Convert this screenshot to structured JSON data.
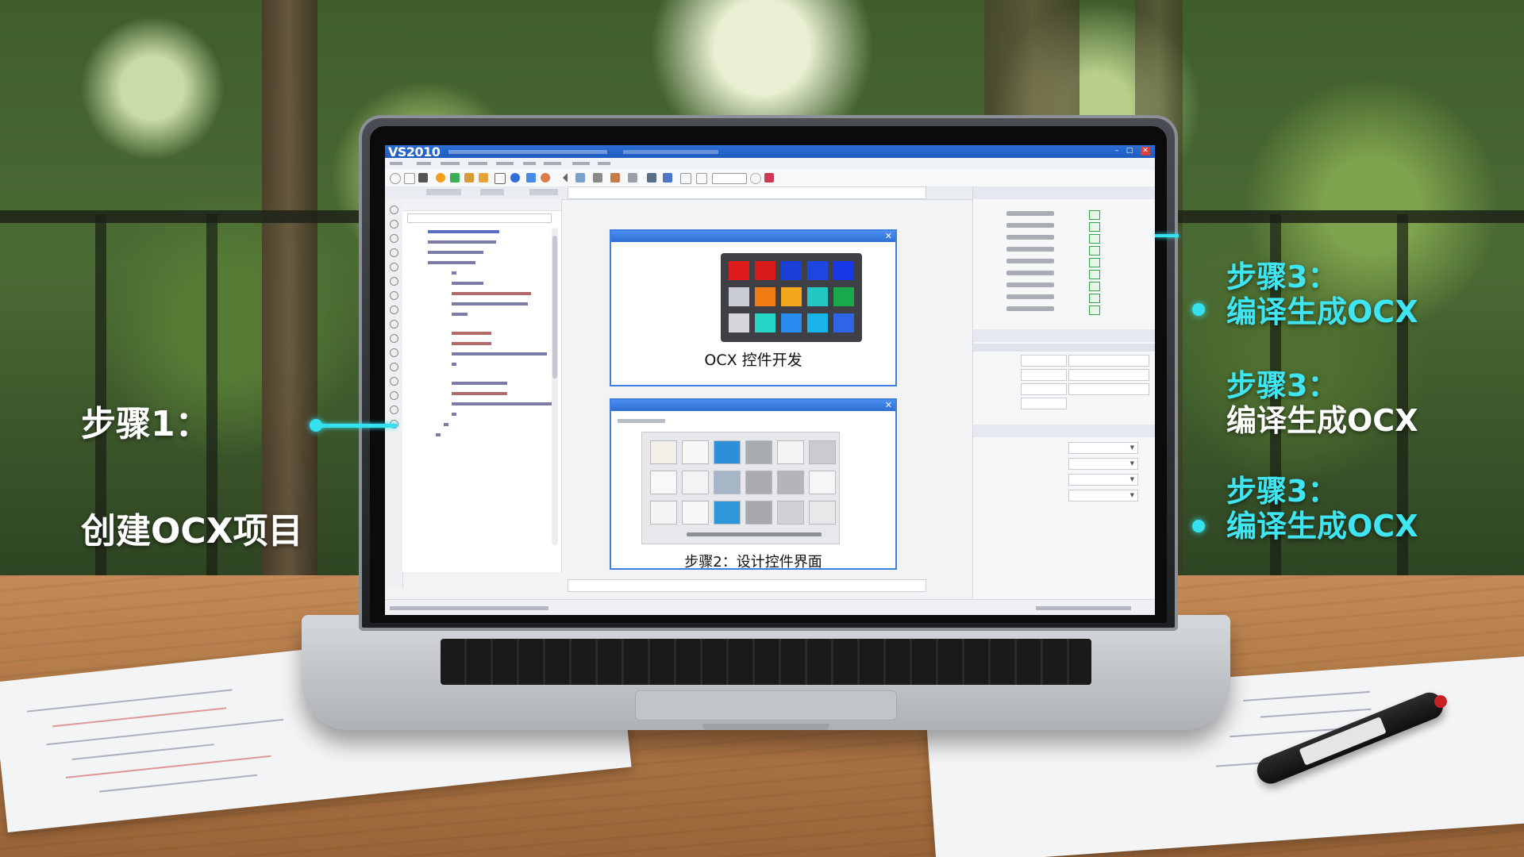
{
  "ide": {
    "app_title": "VS2010",
    "window_controls": [
      "–",
      "□",
      "✕"
    ],
    "ocx_window_caption": "OCX 控件开发",
    "design_window_caption": "步骤2：设计控件界面"
  },
  "annotations": {
    "step1_label": "步骤1：",
    "step1_desc": "创建OCX项目",
    "right_items": [
      {
        "label": "步骤3：",
        "desc": "编译生成OCX"
      },
      {
        "label": "步骤3：",
        "desc": "编译生成OCX"
      },
      {
        "label": "步骤3：",
        "desc": "编译生成OCX"
      }
    ]
  },
  "colors": {
    "annotation_accent": "#35e0ef",
    "title_bar": "#2c6fd6",
    "window_border": "#3f7fe0"
  },
  "palette_swatches": [
    "#e01b1b",
    "#d81a1a",
    "#1a3fd6",
    "#1e46e0",
    "#1838e8",
    "#c9ccd2",
    "#f07c12",
    "#f2a81a",
    "#22c7c4",
    "#19a84a",
    "#d4d6da",
    "#24d4c4",
    "#2a8cf0",
    "#19b3e8",
    "#2e64e6"
  ],
  "design_grid_cells": [
    "#f3efe9",
    "#f7f7f7",
    "#2e8fd8",
    "#a8abb0",
    "#f4f4f4",
    "#c9cbcf",
    "#f8f8f8",
    "#f3f3f3",
    "#a7b6c6",
    "#a9abaf",
    "#b3b5b8",
    "#f6f6f6",
    "#f5f5f5",
    "#f7f7f7",
    "#2f96d9",
    "#a7a9ad",
    "#cfd1d4",
    "#e7e8ea"
  ]
}
